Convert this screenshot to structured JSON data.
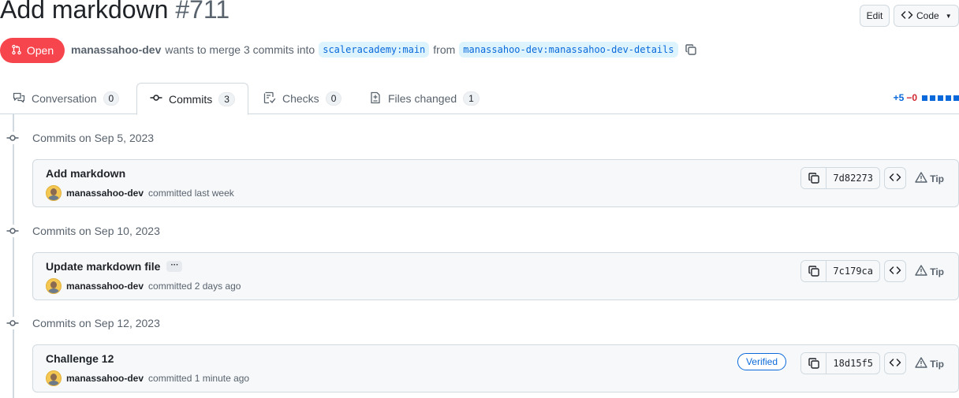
{
  "pr": {
    "title": "Add markdown",
    "number": "#711",
    "state": "Open",
    "author": "manassahoo-dev",
    "merge_text": "wants to merge 3 commits into",
    "base_branch": "scaleracademy:main",
    "from_text": "from",
    "head_branch": "manassahoo-dev:manassahoo-dev-details"
  },
  "header": {
    "edit_label": "Edit",
    "code_label": "Code"
  },
  "tabs": [
    {
      "label": "Conversation",
      "count": "0",
      "icon": "comment-discussion-icon"
    },
    {
      "label": "Commits",
      "count": "3",
      "icon": "git-commit-icon"
    },
    {
      "label": "Checks",
      "count": "0",
      "icon": "checklist-icon"
    },
    {
      "label": "Files changed",
      "count": "1",
      "icon": "file-diff-icon"
    }
  ],
  "diffstat": {
    "additions": "+5",
    "deletions": "−0"
  },
  "groups": [
    {
      "date": "Commits on Sep 5, 2023",
      "commit": {
        "message": "Add markdown",
        "author": "manassahoo-dev",
        "time": "committed last week",
        "sha": "7d82273",
        "tip": "Tip"
      }
    },
    {
      "date": "Commits on Sep 10, 2023",
      "commit": {
        "message": "Update markdown file",
        "ellipsis": "···",
        "author": "manassahoo-dev",
        "time": "committed 2 days ago",
        "sha": "7c179ca",
        "tip": "Tip"
      }
    },
    {
      "date": "Commits on Sep 12, 2023",
      "commit": {
        "message": "Challenge 12",
        "verified": "Verified",
        "author": "manassahoo-dev",
        "time": "committed 1 minute ago",
        "sha": "18d15f5",
        "tip": "Tip"
      }
    }
  ],
  "colors": {
    "open": "#f6454d",
    "accent": "#0969da",
    "deletion": "#d1242f"
  }
}
